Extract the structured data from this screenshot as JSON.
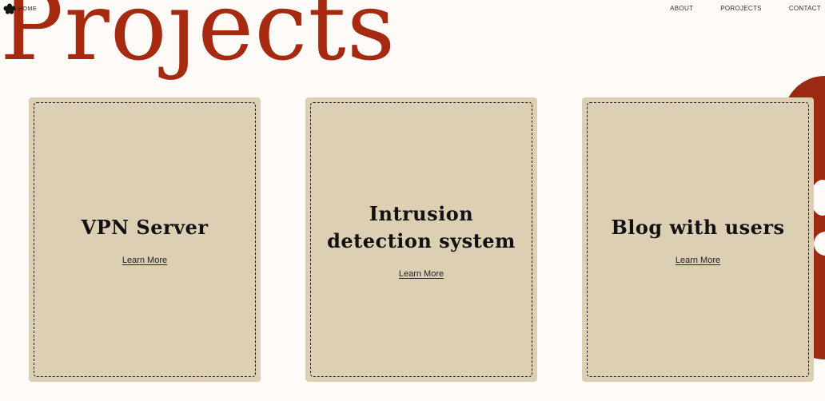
{
  "header": {
    "title": "Projects",
    "home_label": "HOME",
    "nav": [
      "ABOUT",
      "POROJECTS",
      "CONTACT"
    ]
  },
  "cards": [
    {
      "title": "VPN Server",
      "link": "Learn More"
    },
    {
      "title": "Intrusion detection system",
      "link": "Learn More"
    },
    {
      "title": "Blog with users",
      "link": "Learn More"
    }
  ],
  "colors": {
    "background": "#fdfaf7",
    "accent": "#a52a10",
    "card": "#ddcfb4"
  },
  "icons": {
    "home": "flower-icon"
  }
}
